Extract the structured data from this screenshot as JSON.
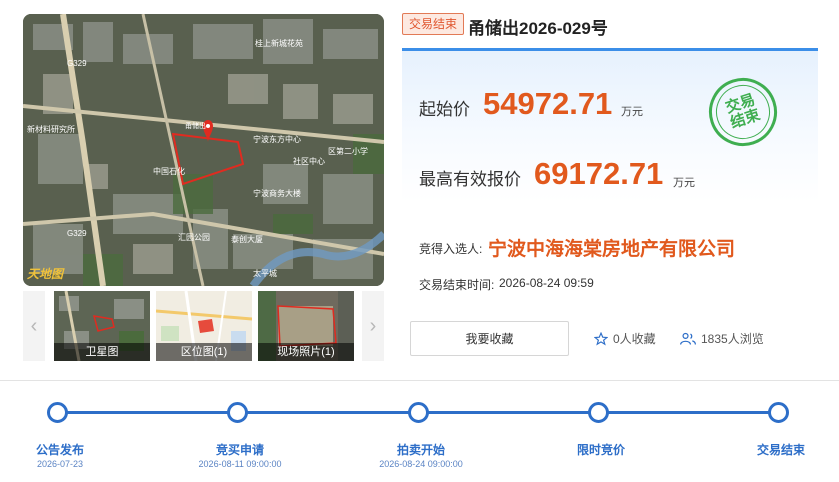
{
  "map": {
    "brand": "天地图",
    "road_labels": [
      "G329",
      "G329"
    ],
    "place_labels": [
      "桂上新城花苑",
      "新材料研究所",
      "宁波东方中心",
      "宁波商务大楼",
      "中国石化",
      "汇园公园",
      "泰创大厦",
      "太平城",
      "社区中心",
      "区第二小学"
    ],
    "marker_label": "甬储出"
  },
  "thumbnails": [
    {
      "caption": "卫星图",
      "icon": "satellite-thumbnail"
    },
    {
      "caption": "区位图(1)",
      "icon": "location-map-thumbnail"
    },
    {
      "caption": "现场照片(1)",
      "icon": "site-photo-thumbnail"
    }
  ],
  "nav": {
    "prev_icon": "chevron-left-icon",
    "next_icon": "chevron-right-icon"
  },
  "header": {
    "status": "交易结束",
    "title": "甬储出2026-029号"
  },
  "prices": {
    "start_label": "起始价",
    "start_value": "54972.71",
    "start_unit": "万元",
    "max_label": "最高有效报价",
    "max_value": "69172.71",
    "max_unit": "万元"
  },
  "stamp": {
    "line1": "交易",
    "line2": "结束"
  },
  "result": {
    "winner_label": "竞得入选人:",
    "winner_name": "宁波中海海棠房地产有限公司",
    "end_time_label": "交易结束时间:",
    "end_time_value": "2026-08-24 09:59"
  },
  "actions": {
    "favorite_button": "我要收藏",
    "favorites_count": "0人收藏",
    "views_count": "1835人浏览",
    "favorites_icon": "star-icon",
    "views_icon": "people-icon"
  },
  "timeline": [
    {
      "label": "公告发布",
      "date": "2026-07-23"
    },
    {
      "label": "竞买申请",
      "date": "2026-08-11 09:00:00"
    },
    {
      "label": "拍卖开始",
      "date": "2026-08-24 09:00:00"
    },
    {
      "label": "限时竞价",
      "date": ""
    },
    {
      "label": "交易结束",
      "date": ""
    }
  ],
  "colors": {
    "accent": "#e1591d",
    "timeline": "#2d6ec8",
    "panel_border": "#3b8ee8",
    "stamp": "#3fae50"
  }
}
